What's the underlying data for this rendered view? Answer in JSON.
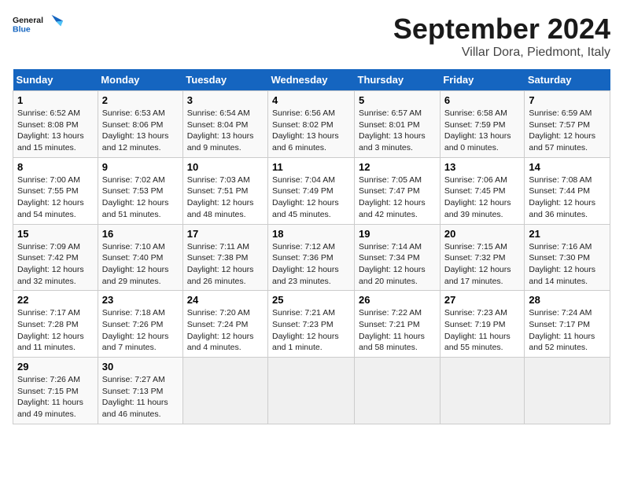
{
  "header": {
    "logo_general": "General",
    "logo_blue": "Blue",
    "month": "September 2024",
    "location": "Villar Dora, Piedmont, Italy"
  },
  "days_of_week": [
    "Sunday",
    "Monday",
    "Tuesday",
    "Wednesday",
    "Thursday",
    "Friday",
    "Saturday"
  ],
  "weeks": [
    [
      {
        "day": 1,
        "sunrise": "6:52 AM",
        "sunset": "8:08 PM",
        "daylight": "13 hours and 15 minutes."
      },
      {
        "day": 2,
        "sunrise": "6:53 AM",
        "sunset": "8:06 PM",
        "daylight": "13 hours and 12 minutes."
      },
      {
        "day": 3,
        "sunrise": "6:54 AM",
        "sunset": "8:04 PM",
        "daylight": "13 hours and 9 minutes."
      },
      {
        "day": 4,
        "sunrise": "6:56 AM",
        "sunset": "8:02 PM",
        "daylight": "13 hours and 6 minutes."
      },
      {
        "day": 5,
        "sunrise": "6:57 AM",
        "sunset": "8:01 PM",
        "daylight": "13 hours and 3 minutes."
      },
      {
        "day": 6,
        "sunrise": "6:58 AM",
        "sunset": "7:59 PM",
        "daylight": "13 hours and 0 minutes."
      },
      {
        "day": 7,
        "sunrise": "6:59 AM",
        "sunset": "7:57 PM",
        "daylight": "12 hours and 57 minutes."
      }
    ],
    [
      {
        "day": 8,
        "sunrise": "7:00 AM",
        "sunset": "7:55 PM",
        "daylight": "12 hours and 54 minutes."
      },
      {
        "day": 9,
        "sunrise": "7:02 AM",
        "sunset": "7:53 PM",
        "daylight": "12 hours and 51 minutes."
      },
      {
        "day": 10,
        "sunrise": "7:03 AM",
        "sunset": "7:51 PM",
        "daylight": "12 hours and 48 minutes."
      },
      {
        "day": 11,
        "sunrise": "7:04 AM",
        "sunset": "7:49 PM",
        "daylight": "12 hours and 45 minutes."
      },
      {
        "day": 12,
        "sunrise": "7:05 AM",
        "sunset": "7:47 PM",
        "daylight": "12 hours and 42 minutes."
      },
      {
        "day": 13,
        "sunrise": "7:06 AM",
        "sunset": "7:45 PM",
        "daylight": "12 hours and 39 minutes."
      },
      {
        "day": 14,
        "sunrise": "7:08 AM",
        "sunset": "7:44 PM",
        "daylight": "12 hours and 36 minutes."
      }
    ],
    [
      {
        "day": 15,
        "sunrise": "7:09 AM",
        "sunset": "7:42 PM",
        "daylight": "12 hours and 32 minutes."
      },
      {
        "day": 16,
        "sunrise": "7:10 AM",
        "sunset": "7:40 PM",
        "daylight": "12 hours and 29 minutes."
      },
      {
        "day": 17,
        "sunrise": "7:11 AM",
        "sunset": "7:38 PM",
        "daylight": "12 hours and 26 minutes."
      },
      {
        "day": 18,
        "sunrise": "7:12 AM",
        "sunset": "7:36 PM",
        "daylight": "12 hours and 23 minutes."
      },
      {
        "day": 19,
        "sunrise": "7:14 AM",
        "sunset": "7:34 PM",
        "daylight": "12 hours and 20 minutes."
      },
      {
        "day": 20,
        "sunrise": "7:15 AM",
        "sunset": "7:32 PM",
        "daylight": "12 hours and 17 minutes."
      },
      {
        "day": 21,
        "sunrise": "7:16 AM",
        "sunset": "7:30 PM",
        "daylight": "12 hours and 14 minutes."
      }
    ],
    [
      {
        "day": 22,
        "sunrise": "7:17 AM",
        "sunset": "7:28 PM",
        "daylight": "12 hours and 11 minutes."
      },
      {
        "day": 23,
        "sunrise": "7:18 AM",
        "sunset": "7:26 PM",
        "daylight": "12 hours and 7 minutes."
      },
      {
        "day": 24,
        "sunrise": "7:20 AM",
        "sunset": "7:24 PM",
        "daylight": "12 hours and 4 minutes."
      },
      {
        "day": 25,
        "sunrise": "7:21 AM",
        "sunset": "7:23 PM",
        "daylight": "12 hours and 1 minute."
      },
      {
        "day": 26,
        "sunrise": "7:22 AM",
        "sunset": "7:21 PM",
        "daylight": "11 hours and 58 minutes."
      },
      {
        "day": 27,
        "sunrise": "7:23 AM",
        "sunset": "7:19 PM",
        "daylight": "11 hours and 55 minutes."
      },
      {
        "day": 28,
        "sunrise": "7:24 AM",
        "sunset": "7:17 PM",
        "daylight": "11 hours and 52 minutes."
      }
    ],
    [
      {
        "day": 29,
        "sunrise": "7:26 AM",
        "sunset": "7:15 PM",
        "daylight": "11 hours and 49 minutes."
      },
      {
        "day": 30,
        "sunrise": "7:27 AM",
        "sunset": "7:13 PM",
        "daylight": "11 hours and 46 minutes."
      },
      null,
      null,
      null,
      null,
      null
    ]
  ]
}
